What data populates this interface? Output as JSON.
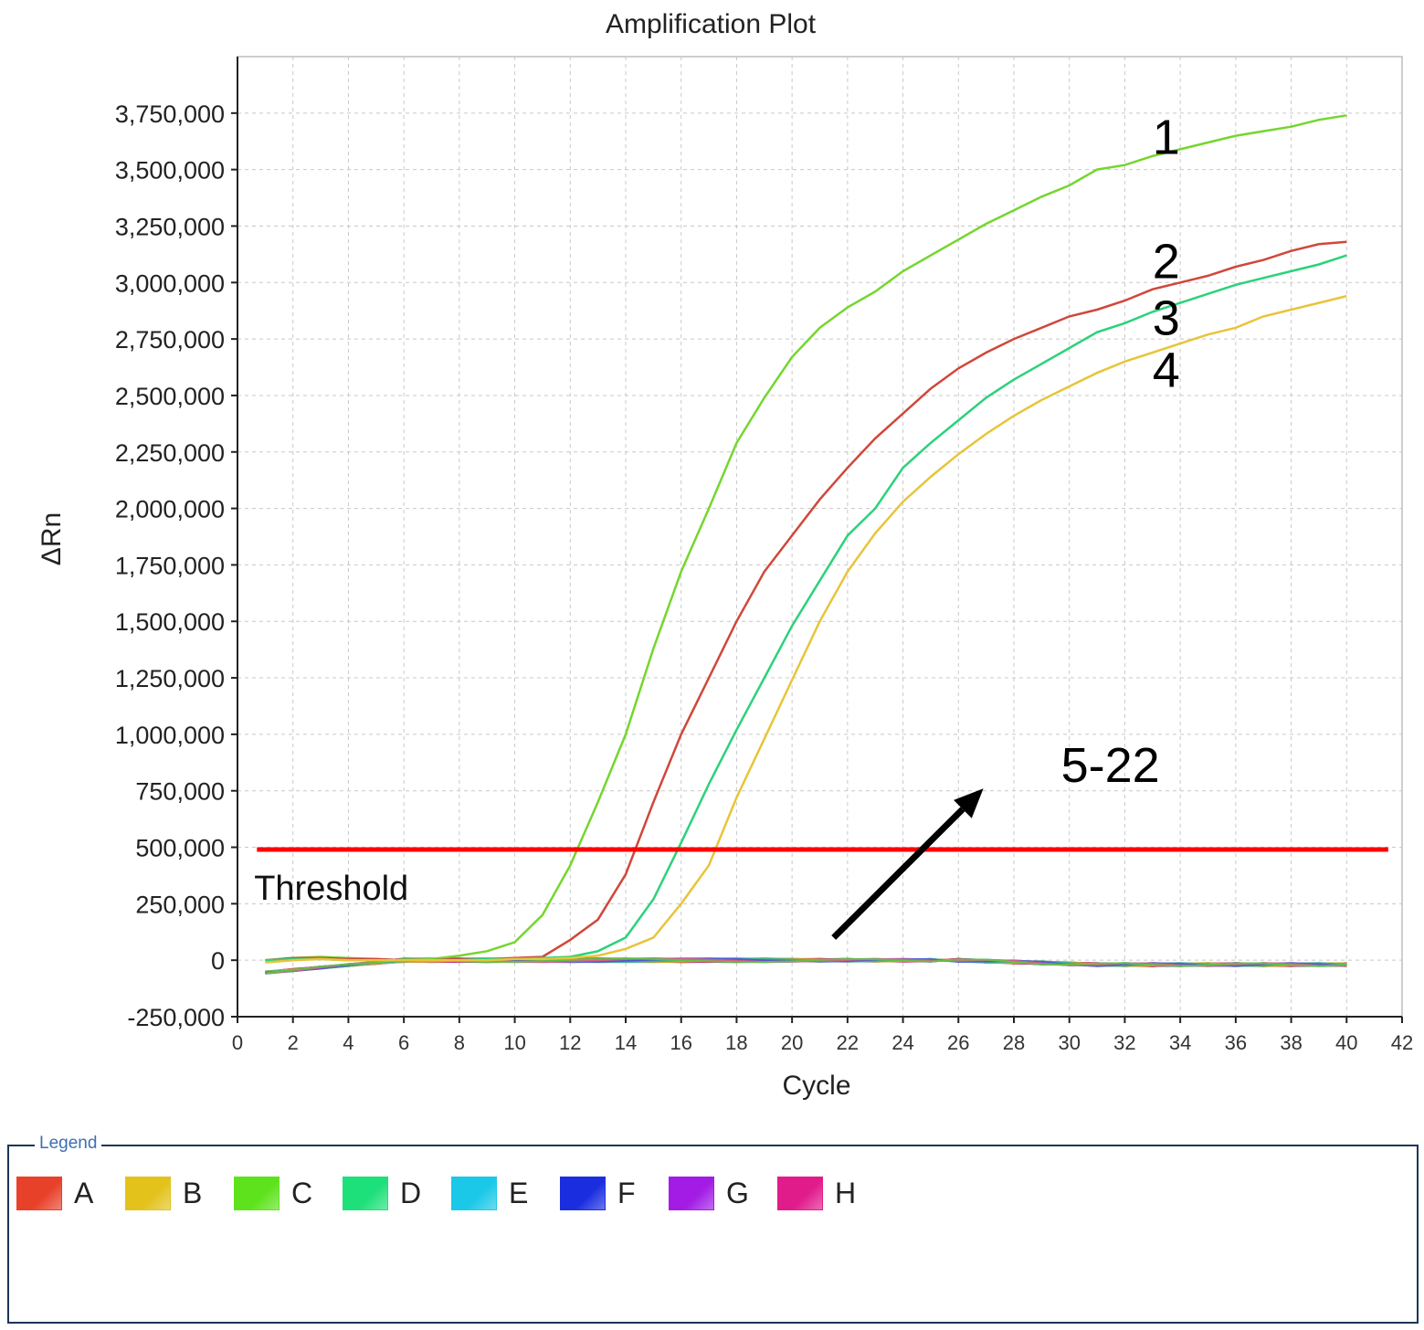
{
  "chart_data": {
    "type": "line",
    "title": "Amplification Plot",
    "xlabel": "Cycle",
    "ylabel": "ΔRn",
    "xlim": [
      0,
      42
    ],
    "ylim": [
      -250000,
      4000000
    ],
    "xticks": [
      0,
      2,
      4,
      6,
      8,
      10,
      12,
      14,
      16,
      18,
      20,
      22,
      24,
      26,
      28,
      30,
      32,
      34,
      36,
      38,
      40,
      42
    ],
    "yticks": [
      -250000,
      0,
      250000,
      500000,
      750000,
      1000000,
      1250000,
      1500000,
      1750000,
      2000000,
      2250000,
      2500000,
      2750000,
      3000000,
      3250000,
      3500000,
      3750000
    ],
    "grid": true,
    "threshold": {
      "label": "Threshold",
      "value": 490000,
      "color": "#ff0000"
    },
    "annotations": [
      {
        "text": "1",
        "x": 33,
        "y": 3650000
      },
      {
        "text": "2",
        "x": 33,
        "y": 3100000
      },
      {
        "text": "3",
        "x": 33,
        "y": 2850000
      },
      {
        "text": "4",
        "x": 33,
        "y": 2620000
      },
      {
        "text": "5-22",
        "x": 29.7,
        "y": 870000
      }
    ],
    "arrow": {
      "from": [
        21.5,
        100000
      ],
      "to": [
        26.9,
        760000
      ]
    },
    "series": [
      {
        "name": "1",
        "color": "#74d62e",
        "x": [
          1,
          2,
          3,
          4,
          5,
          6,
          7,
          8,
          9,
          10,
          11,
          12,
          13,
          14,
          15,
          16,
          17,
          18,
          19,
          20,
          21,
          22,
          23,
          24,
          25,
          26,
          27,
          28,
          29,
          30,
          31,
          32,
          33,
          34,
          35,
          36,
          37,
          38,
          39,
          40
        ],
        "values": [
          0,
          10000,
          15000,
          10000,
          5000,
          0,
          5000,
          20000,
          40000,
          80000,
          200000,
          420000,
          700000,
          1000000,
          1380000,
          1720000,
          2000000,
          2290000,
          2490000,
          2670000,
          2800000,
          2890000,
          2960000,
          3050000,
          3120000,
          3190000,
          3260000,
          3320000,
          3380000,
          3430000,
          3500000,
          3520000,
          3560000,
          3590000,
          3620000,
          3650000,
          3670000,
          3690000,
          3720000,
          3740000
        ]
      },
      {
        "name": "2",
        "color": "#d0473a",
        "x": [
          1,
          2,
          3,
          4,
          5,
          6,
          7,
          8,
          9,
          10,
          11,
          12,
          13,
          14,
          15,
          16,
          17,
          18,
          19,
          20,
          21,
          22,
          23,
          24,
          25,
          26,
          27,
          28,
          29,
          30,
          31,
          32,
          33,
          34,
          35,
          36,
          37,
          38,
          39,
          40
        ],
        "values": [
          0,
          10000,
          10000,
          5000,
          5000,
          0,
          0,
          5000,
          5000,
          10000,
          15000,
          90000,
          180000,
          380000,
          700000,
          1000000,
          1250000,
          1500000,
          1720000,
          1880000,
          2040000,
          2180000,
          2310000,
          2420000,
          2530000,
          2620000,
          2690000,
          2750000,
          2800000,
          2850000,
          2880000,
          2920000,
          2970000,
          3000000,
          3030000,
          3070000,
          3100000,
          3140000,
          3170000,
          3180000
        ]
      },
      {
        "name": "3",
        "color": "#2bd27a",
        "x": [
          1,
          2,
          3,
          4,
          5,
          6,
          7,
          8,
          9,
          10,
          11,
          12,
          13,
          14,
          15,
          16,
          17,
          18,
          19,
          20,
          21,
          22,
          23,
          24,
          25,
          26,
          27,
          28,
          29,
          30,
          31,
          32,
          33,
          34,
          35,
          36,
          37,
          38,
          39,
          40
        ],
        "values": [
          0,
          5000,
          5000,
          0,
          0,
          0,
          0,
          0,
          5000,
          5000,
          10000,
          15000,
          40000,
          100000,
          270000,
          520000,
          780000,
          1020000,
          1250000,
          1480000,
          1680000,
          1880000,
          2000000,
          2180000,
          2290000,
          2390000,
          2490000,
          2570000,
          2640000,
          2710000,
          2780000,
          2820000,
          2870000,
          2910000,
          2950000,
          2990000,
          3020000,
          3050000,
          3080000,
          3120000
        ]
      },
      {
        "name": "4",
        "color": "#e8c43a",
        "x": [
          1,
          2,
          3,
          4,
          5,
          6,
          7,
          8,
          9,
          10,
          11,
          12,
          13,
          14,
          15,
          16,
          17,
          18,
          19,
          20,
          21,
          22,
          23,
          24,
          25,
          26,
          27,
          28,
          29,
          30,
          31,
          32,
          33,
          34,
          35,
          36,
          37,
          38,
          39,
          40
        ],
        "values": [
          -10000,
          0,
          5000,
          0,
          0,
          0,
          0,
          0,
          0,
          5000,
          5000,
          10000,
          20000,
          50000,
          100000,
          250000,
          420000,
          720000,
          980000,
          1240000,
          1500000,
          1720000,
          1890000,
          2030000,
          2140000,
          2240000,
          2330000,
          2410000,
          2480000,
          2540000,
          2600000,
          2650000,
          2690000,
          2730000,
          2770000,
          2800000,
          2850000,
          2880000,
          2910000,
          2940000
        ]
      }
    ],
    "legend": {
      "title": "Legend",
      "placement": "bottom",
      "items": [
        {
          "label": "A",
          "color": "#e8412a"
        },
        {
          "label": "B",
          "color": "#e3c21c"
        },
        {
          "label": "C",
          "color": "#5ee21c"
        },
        {
          "label": "D",
          "color": "#1ee07a"
        },
        {
          "label": "E",
          "color": "#1cc8e8"
        },
        {
          "label": "F",
          "color": "#1a2ee0"
        },
        {
          "label": "G",
          "color": "#a21ce6"
        },
        {
          "label": "H",
          "color": "#e01c8a"
        }
      ]
    }
  }
}
